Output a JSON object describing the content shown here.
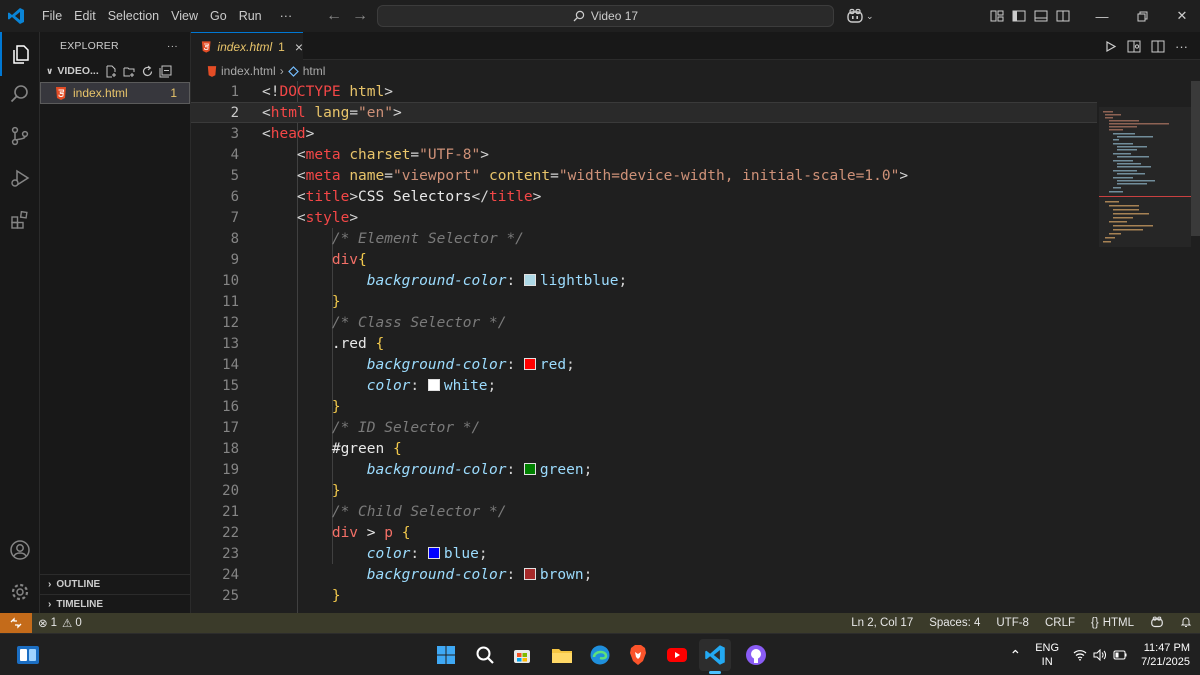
{
  "titlebar": {
    "menu": [
      "File",
      "Edit",
      "Selection",
      "View",
      "Go",
      "Run",
      "···"
    ],
    "search_text": "Video 17",
    "colors": {
      "accent": "#0078d4",
      "bg": "#1f1f1f"
    }
  },
  "sidebar": {
    "title": "EXPLORER",
    "more": "···",
    "folder_name": "VIDEO...",
    "file": {
      "name": "index.html",
      "problems": "1"
    },
    "outline": "OUTLINE",
    "timeline": "TIMELINE"
  },
  "editor": {
    "tab": {
      "name": "index.html",
      "problems": "1",
      "close": "×"
    },
    "breadcrumb": {
      "file": "index.html",
      "node": "html"
    },
    "current_line": 2,
    "lines": [
      {
        "n": "1",
        "segs": [
          [
            "p",
            "<!"
          ],
          [
            "tag",
            "DOCTYPE "
          ],
          [
            "attr",
            "html"
          ],
          [
            "p",
            ">"
          ]
        ]
      },
      {
        "n": "2",
        "segs": [
          [
            "p",
            "<"
          ],
          [
            "tag",
            "html "
          ],
          [
            "attr",
            "lang"
          ],
          [
            "p",
            "="
          ],
          [
            "str",
            "\"en\""
          ],
          [
            "p",
            ">"
          ]
        ]
      },
      {
        "n": "3",
        "segs": [
          [
            "p",
            "<"
          ],
          [
            "tag",
            "head"
          ],
          [
            "p",
            ">"
          ]
        ]
      },
      {
        "n": "4",
        "segs": [
          [
            "p",
            "    <"
          ],
          [
            "tag",
            "meta "
          ],
          [
            "attr",
            "charset"
          ],
          [
            "p",
            "="
          ],
          [
            "str",
            "\"UTF-8\""
          ],
          [
            "p",
            ">"
          ]
        ]
      },
      {
        "n": "5",
        "segs": [
          [
            "p",
            "    <"
          ],
          [
            "tag",
            "meta "
          ],
          [
            "attr",
            "name"
          ],
          [
            "p",
            "="
          ],
          [
            "str",
            "\"viewport\" "
          ],
          [
            "attr",
            "content"
          ],
          [
            "p",
            "="
          ],
          [
            "str",
            "\"width=device-width, initial-scale=1.0\""
          ],
          [
            "p",
            ">"
          ]
        ]
      },
      {
        "n": "6",
        "segs": [
          [
            "p",
            "    <"
          ],
          [
            "tag",
            "title"
          ],
          [
            "p",
            ">"
          ],
          [
            "text",
            "CSS Selectors"
          ],
          [
            "p",
            "</"
          ],
          [
            "tag",
            "title"
          ],
          [
            "p",
            ">"
          ]
        ]
      },
      {
        "n": "7",
        "segs": [
          [
            "p",
            "    <"
          ],
          [
            "tag",
            "style"
          ],
          [
            "p",
            ">"
          ]
        ]
      },
      {
        "n": "8",
        "segs": [
          [
            "p",
            "        "
          ],
          [
            "com",
            "/* Element Selector */"
          ]
        ]
      },
      {
        "n": "9",
        "segs": [
          [
            "p",
            "        "
          ],
          [
            "sel",
            "div"
          ],
          [
            "brace",
            "{"
          ]
        ]
      },
      {
        "n": "10",
        "segs": [
          [
            "p",
            "            "
          ],
          [
            "prop",
            "background-color"
          ],
          [
            "p",
            ": "
          ],
          [
            "sw",
            "#add8e6"
          ],
          [
            "val",
            "lightblue"
          ],
          [
            "p",
            ";"
          ]
        ]
      },
      {
        "n": "11",
        "segs": [
          [
            "p",
            "        "
          ],
          [
            "brace",
            "}"
          ]
        ]
      },
      {
        "n": "12",
        "segs": [
          [
            "p",
            "        "
          ],
          [
            "com",
            "/* Class Selector */"
          ]
        ]
      },
      {
        "n": "13",
        "segs": [
          [
            "p",
            "        "
          ],
          [
            "text",
            ".red "
          ],
          [
            "brace",
            "{"
          ]
        ]
      },
      {
        "n": "14",
        "segs": [
          [
            "p",
            "            "
          ],
          [
            "prop",
            "background-color"
          ],
          [
            "p",
            ": "
          ],
          [
            "sw",
            "#ff0000"
          ],
          [
            "val",
            "red"
          ],
          [
            "p",
            ";"
          ]
        ]
      },
      {
        "n": "15",
        "segs": [
          [
            "p",
            "            "
          ],
          [
            "prop",
            "color"
          ],
          [
            "p",
            ": "
          ],
          [
            "sw",
            "#ffffff"
          ],
          [
            "val",
            "white"
          ],
          [
            "p",
            ";"
          ]
        ]
      },
      {
        "n": "16",
        "segs": [
          [
            "p",
            "        "
          ],
          [
            "brace",
            "}"
          ]
        ]
      },
      {
        "n": "17",
        "segs": [
          [
            "p",
            "        "
          ],
          [
            "com",
            "/* ID Selector */"
          ]
        ]
      },
      {
        "n": "18",
        "segs": [
          [
            "p",
            "        "
          ],
          [
            "text",
            "#green "
          ],
          [
            "brace",
            "{"
          ]
        ]
      },
      {
        "n": "19",
        "segs": [
          [
            "p",
            "            "
          ],
          [
            "prop",
            "background-color"
          ],
          [
            "p",
            ": "
          ],
          [
            "sw",
            "#008000"
          ],
          [
            "val",
            "green"
          ],
          [
            "p",
            ";"
          ]
        ]
      },
      {
        "n": "20",
        "segs": [
          [
            "p",
            "        "
          ],
          [
            "brace",
            "}"
          ]
        ]
      },
      {
        "n": "21",
        "segs": [
          [
            "p",
            "        "
          ],
          [
            "com",
            "/* Child Selector */"
          ]
        ]
      },
      {
        "n": "22",
        "segs": [
          [
            "p",
            "        "
          ],
          [
            "sel",
            "div "
          ],
          [
            "text",
            "> "
          ],
          [
            "sel",
            "p "
          ],
          [
            "brace",
            "{"
          ]
        ]
      },
      {
        "n": "23",
        "segs": [
          [
            "p",
            "            "
          ],
          [
            "prop",
            "color"
          ],
          [
            "p",
            ": "
          ],
          [
            "sw",
            "#0000ff"
          ],
          [
            "val",
            "blue"
          ],
          [
            "p",
            ";"
          ]
        ]
      },
      {
        "n": "24",
        "segs": [
          [
            "p",
            "            "
          ],
          [
            "prop",
            "background-color"
          ],
          [
            "p",
            ": "
          ],
          [
            "sw",
            "#a52a2a"
          ],
          [
            "val",
            "brown"
          ],
          [
            "p",
            ";"
          ]
        ]
      },
      {
        "n": "25",
        "segs": [
          [
            "p",
            "        "
          ],
          [
            "brace",
            "}"
          ]
        ]
      }
    ]
  },
  "statusbar": {
    "errors": "1",
    "warnings": "0",
    "position": "Ln 2, Col 17",
    "spaces": "Spaces: 4",
    "encoding": "UTF-8",
    "eol": "CRLF",
    "language": "HTML"
  },
  "taskbar": {
    "lang": "ENG",
    "region": "IN",
    "time": "11:47 PM",
    "date": "7/21/2025"
  }
}
